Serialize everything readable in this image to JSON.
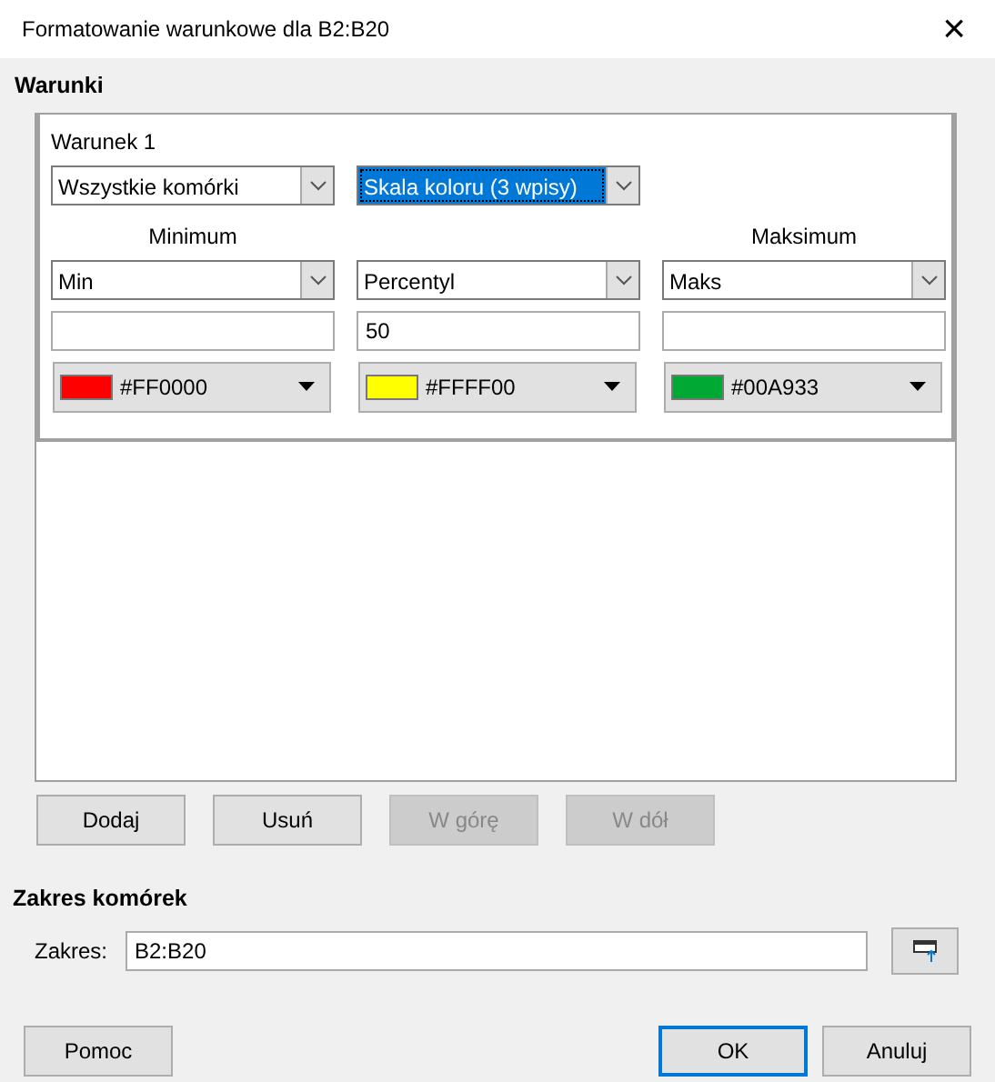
{
  "window": {
    "title": "Formatowanie warunkowe dla B2:B20",
    "close": "×"
  },
  "conditions": {
    "heading": "Warunki",
    "items": [
      {
        "label": "Warunek 1",
        "selectors": [
          {
            "value": "Wszystkie komórki",
            "focused": false
          },
          {
            "value": "Skala koloru (3 wpisy)",
            "focused": true
          }
        ],
        "columns": [
          {
            "heading": "Minimum",
            "type": "Min",
            "color": "#ff0000",
            "color_label": "#FF0000"
          },
          {
            "type": "Percentyl",
            "value": "50",
            "color": "#ffff00",
            "color_label": "#FFFF00"
          },
          {
            "heading": "Maksimum",
            "type": "Maks",
            "color": "#00a933",
            "color_label": "#00A933"
          }
        ]
      }
    ]
  },
  "list_buttons": [
    {
      "label": "Dodaj",
      "disabled": false
    },
    {
      "label": "Usuń",
      "disabled": false
    },
    {
      "label": "W górę",
      "disabled": true
    },
    {
      "label": "W dół",
      "disabled": true
    }
  ],
  "range": {
    "heading": "Zakres komórek",
    "label": "Zakres:",
    "value": "B2:B20"
  },
  "buttons": [
    {
      "label": "Pomoc",
      "default": false
    },
    {
      "label": "OK",
      "default": true
    },
    {
      "label": "Anuluj",
      "default": false
    }
  ]
}
